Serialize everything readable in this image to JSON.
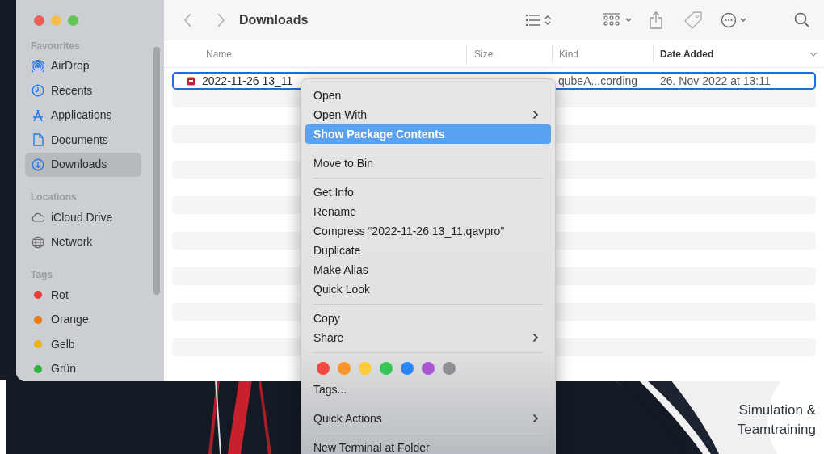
{
  "toolbar": {
    "title": "Downloads"
  },
  "sidebar": {
    "sections": [
      {
        "heading": "Favourites",
        "items": [
          {
            "kind": "airdrop",
            "label": "AirDrop",
            "selected": false
          },
          {
            "kind": "recents",
            "label": "Recents",
            "selected": false
          },
          {
            "kind": "applications",
            "label": "Applications",
            "selected": false
          },
          {
            "kind": "documents",
            "label": "Documents",
            "selected": false
          },
          {
            "kind": "downloads",
            "label": "Downloads",
            "selected": true
          }
        ]
      },
      {
        "heading": "Locations",
        "items": [
          {
            "kind": "icloud",
            "label": "iCloud Drive",
            "selected": false
          },
          {
            "kind": "network",
            "label": "Network",
            "selected": false
          }
        ]
      },
      {
        "heading": "Tags",
        "items": [
          {
            "kind": "tag",
            "label": "Rot",
            "color": "#ec3a34",
            "selected": false
          },
          {
            "kind": "tag",
            "label": "Orange",
            "color": "#e8780f",
            "selected": false
          },
          {
            "kind": "tag",
            "label": "Gelb",
            "color": "#e8b50e",
            "selected": false
          },
          {
            "kind": "tag",
            "label": "Grün",
            "color": "#27b534",
            "selected": false
          }
        ]
      }
    ]
  },
  "table": {
    "columns": [
      {
        "label": "Name",
        "sorted": false
      },
      {
        "label": "Size",
        "sorted": false
      },
      {
        "label": "Kind",
        "sorted": false
      },
      {
        "label": "Date Added",
        "sorted": true
      }
    ],
    "rows": [
      {
        "name": "2022-11-26 13_11",
        "file_kind": "qubeA...cording",
        "date_added": "26. Nov 2022 at 13:11",
        "selected": true
      }
    ]
  },
  "context_menu": {
    "items": [
      {
        "kind": "item",
        "label": "Open",
        "submenu": false,
        "selected": false
      },
      {
        "kind": "item",
        "label": "Open With",
        "submenu": true,
        "selected": false
      },
      {
        "kind": "item",
        "label": "Show Package Contents",
        "submenu": false,
        "selected": true
      },
      {
        "kind": "separator"
      },
      {
        "kind": "item",
        "label": "Move to Bin",
        "submenu": false,
        "selected": false
      },
      {
        "kind": "separator"
      },
      {
        "kind": "item",
        "label": "Get Info",
        "submenu": false,
        "selected": false
      },
      {
        "kind": "item",
        "label": "Rename",
        "submenu": false,
        "selected": false
      },
      {
        "kind": "item",
        "label": "Compress “2022-11-26 13_11.qavpro”",
        "submenu": false,
        "selected": false
      },
      {
        "kind": "item",
        "label": "Duplicate",
        "submenu": false,
        "selected": false
      },
      {
        "kind": "item",
        "label": "Make Alias",
        "submenu": false,
        "selected": false
      },
      {
        "kind": "item",
        "label": "Quick Look",
        "submenu": false,
        "selected": false
      },
      {
        "kind": "separator"
      },
      {
        "kind": "item",
        "label": "Copy",
        "submenu": false,
        "selected": false
      },
      {
        "kind": "item",
        "label": "Share",
        "submenu": true,
        "selected": false
      },
      {
        "kind": "separator"
      },
      {
        "kind": "tag_colors",
        "dots": [
          {
            "color": "#f04a45"
          },
          {
            "color": "#f7962f"
          },
          {
            "color": "#fbcc3b"
          },
          {
            "color": "#37c556"
          },
          {
            "color": "#2a85f6"
          },
          {
            "color": "#a857d1"
          },
          {
            "color": "#8e8e93"
          }
        ]
      },
      {
        "kind": "item",
        "label": "Tags...",
        "submenu": false,
        "selected": false
      },
      {
        "kind": "separator"
      },
      {
        "kind": "item",
        "label": "Quick Actions",
        "submenu": true,
        "selected": false
      },
      {
        "kind": "separator"
      },
      {
        "kind": "item",
        "label": "New Terminal at Folder",
        "submenu": false,
        "selected": false
      }
    ]
  },
  "desktop": {
    "logo_lines": [
      "Simulation &",
      "Teamtraining"
    ]
  }
}
